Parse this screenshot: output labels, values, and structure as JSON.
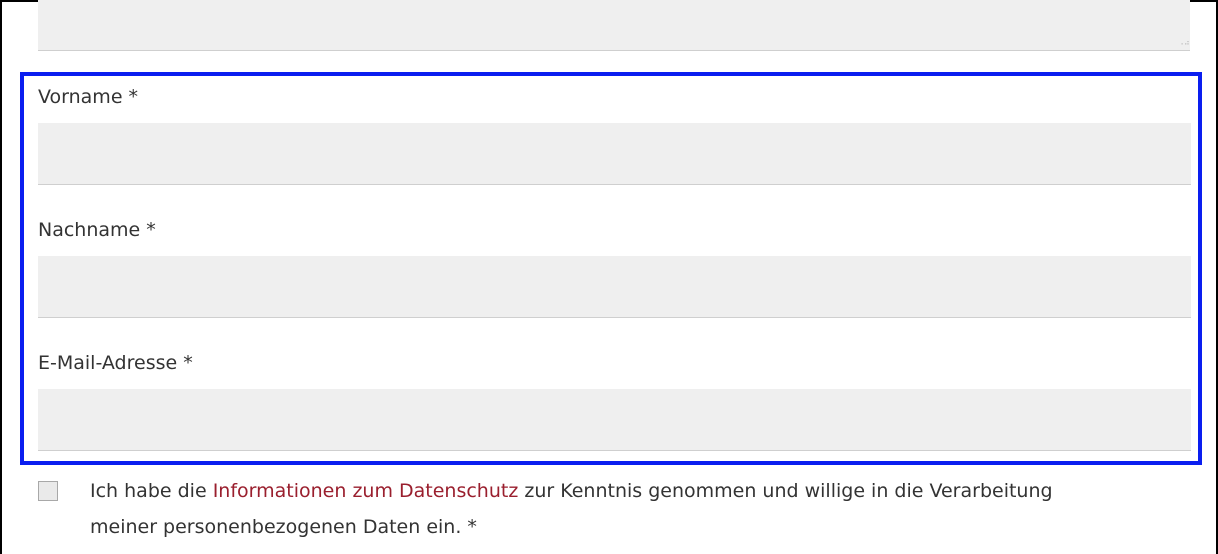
{
  "form": {
    "fields": [
      {
        "label": "Vorname *",
        "value": "",
        "placeholder": ""
      },
      {
        "label": "Nachname *",
        "value": "",
        "placeholder": ""
      },
      {
        "label": "E-Mail-Adresse *",
        "value": "",
        "placeholder": ""
      }
    ],
    "consent": {
      "checked": false,
      "text_before": "Ich habe die ",
      "link_text": "Informationen zum Datenschutz",
      "text_after": " zur Kenntnis genommen und willige in die Verarbeitung meiner personenbezogenen Daten ein. *"
    }
  },
  "colors": {
    "highlight_border": "#0a1ef0",
    "link": "#9a1f2e",
    "input_background": "#efefef"
  }
}
